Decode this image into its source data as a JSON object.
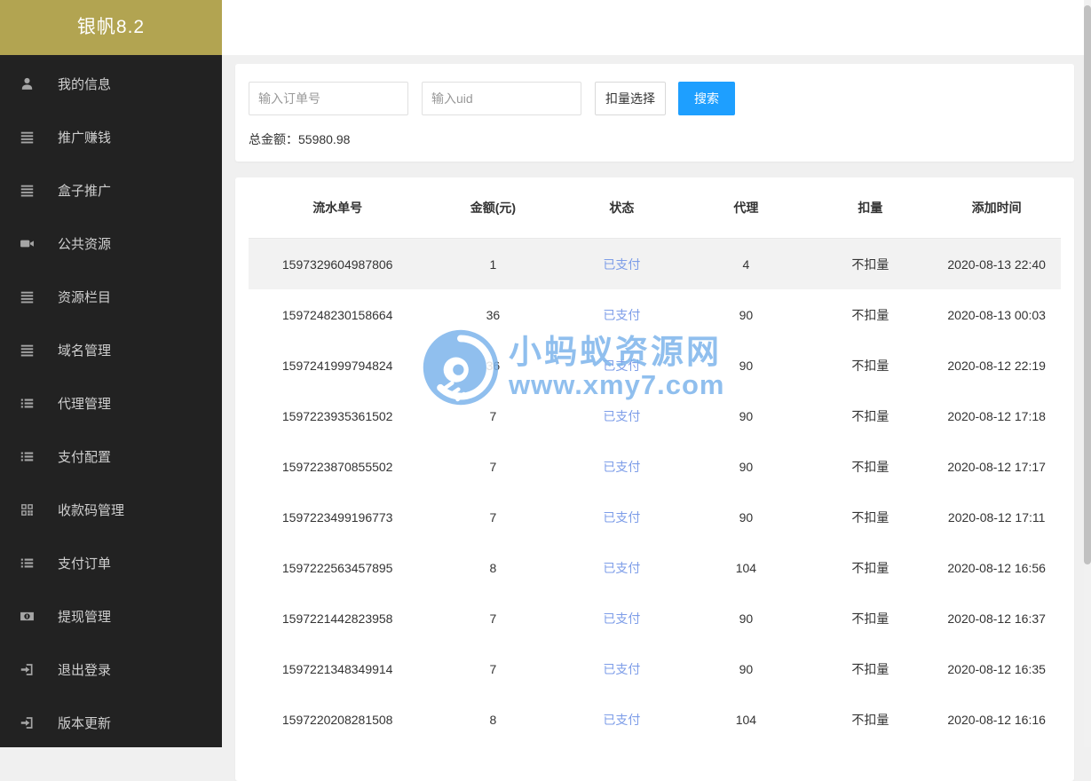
{
  "brand": {
    "title": "银帆8.2"
  },
  "sidebar": {
    "items": [
      {
        "id": "my-info",
        "label": "我的信息",
        "icon": "user-icon"
      },
      {
        "id": "promote-earn",
        "label": "推广赚钱",
        "icon": "list-icon"
      },
      {
        "id": "box-promote",
        "label": "盒子推广",
        "icon": "list-icon"
      },
      {
        "id": "public-resource",
        "label": "公共资源",
        "icon": "video-icon"
      },
      {
        "id": "resource-column",
        "label": "资源栏目",
        "icon": "list-icon"
      },
      {
        "id": "domain-manage",
        "label": "域名管理",
        "icon": "list-icon"
      },
      {
        "id": "agent-manage",
        "label": "代理管理",
        "icon": "list-ul-icon"
      },
      {
        "id": "pay-config",
        "label": "支付配置",
        "icon": "list-ul-icon"
      },
      {
        "id": "qrcode-manage",
        "label": "收款码管理",
        "icon": "qrcode-icon"
      },
      {
        "id": "pay-order",
        "label": "支付订单",
        "icon": "list-ul-icon"
      },
      {
        "id": "withdraw-manage",
        "label": "提现管理",
        "icon": "money-icon"
      },
      {
        "id": "logout",
        "label": "退出登录",
        "icon": "signout-icon"
      },
      {
        "id": "version-update",
        "label": "版本更新",
        "icon": "signout-icon"
      }
    ]
  },
  "search": {
    "order_placeholder": "输入订单号",
    "uid_placeholder": "输入uid",
    "deduct_select_label": "扣量选择",
    "search_label": "搜索",
    "total_text": "总金额：55980.98"
  },
  "table": {
    "columns": [
      "流水单号",
      "金额(元)",
      "状态",
      "代理",
      "扣量",
      "添加时间"
    ],
    "rows": [
      {
        "order": "1597329604987806",
        "amount": "1",
        "status": "已支付",
        "agent": "4",
        "deduct": "不扣量",
        "time": "2020-08-13 22:40",
        "highlighted": true
      },
      {
        "order": "1597248230158664",
        "amount": "36",
        "status": "已支付",
        "agent": "90",
        "deduct": "不扣量",
        "time": "2020-08-13 00:03",
        "highlighted": false
      },
      {
        "order": "1597241999794824",
        "amount": "36",
        "status": "已支付",
        "agent": "90",
        "deduct": "不扣量",
        "time": "2020-08-12 22:19",
        "highlighted": false
      },
      {
        "order": "1597223935361502",
        "amount": "7",
        "status": "已支付",
        "agent": "90",
        "deduct": "不扣量",
        "time": "2020-08-12 17:18",
        "highlighted": false
      },
      {
        "order": "1597223870855502",
        "amount": "7",
        "status": "已支付",
        "agent": "90",
        "deduct": "不扣量",
        "time": "2020-08-12 17:17",
        "highlighted": false
      },
      {
        "order": "1597223499196773",
        "amount": "7",
        "status": "已支付",
        "agent": "90",
        "deduct": "不扣量",
        "time": "2020-08-12 17:11",
        "highlighted": false
      },
      {
        "order": "1597222563457895",
        "amount": "8",
        "status": "已支付",
        "agent": "104",
        "deduct": "不扣量",
        "time": "2020-08-12 16:56",
        "highlighted": false
      },
      {
        "order": "1597221442823958",
        "amount": "7",
        "status": "已支付",
        "agent": "90",
        "deduct": "不扣量",
        "time": "2020-08-12 16:37",
        "highlighted": false
      },
      {
        "order": "1597221348349914",
        "amount": "7",
        "status": "已支付",
        "agent": "90",
        "deduct": "不扣量",
        "time": "2020-08-12 16:35",
        "highlighted": false
      },
      {
        "order": "1597220208281508",
        "amount": "8",
        "status": "已支付",
        "agent": "104",
        "deduct": "不扣量",
        "time": "2020-08-12 16:16",
        "highlighted": false
      }
    ]
  },
  "watermark": {
    "line1": "小蚂蚁资源网",
    "line2": "www.xmy7.com"
  },
  "colors": {
    "brand_gold": "#b2a451",
    "sidebar_bg": "#222222",
    "primary_blue": "#1E9FFF",
    "status_paid_blue": "#7d9de8",
    "watermark_blue": "#7db5ec",
    "row_highlight": "#f2f2f2"
  }
}
